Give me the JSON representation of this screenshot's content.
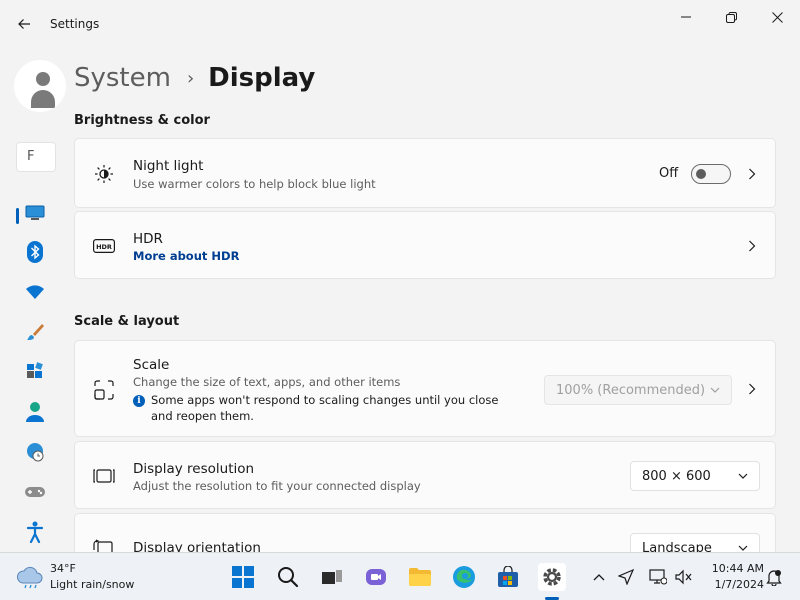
{
  "window": {
    "title": "Settings"
  },
  "nav": {
    "search_placeholder": "F"
  },
  "breadcrumb": {
    "parent": "System",
    "separator": "›",
    "current": "Display"
  },
  "sections": {
    "brightness_title": "Brightness & color",
    "scale_title": "Scale & layout"
  },
  "night_light": {
    "title": "Night light",
    "description": "Use warmer colors to help block blue light",
    "state_label": "Off"
  },
  "hdr": {
    "title": "HDR",
    "link": "More about HDR"
  },
  "scale": {
    "title": "Scale",
    "description": "Change the size of text, apps, and other items",
    "info": "Some apps won't respond to scaling changes until you close and reopen them.",
    "selected": "100% (Recommended)"
  },
  "resolution": {
    "title": "Display resolution",
    "description": "Adjust the resolution to fit your connected display",
    "selected": "800 × 600"
  },
  "orientation": {
    "title": "Display orientation",
    "selected": "Landscape"
  },
  "taskbar": {
    "weather_temp": "34°F",
    "weather_desc": "Light rain/snow",
    "time": "10:44 AM",
    "date": "1/7/2024"
  },
  "colors": {
    "accent": "#005fb8",
    "link": "#003e92"
  }
}
